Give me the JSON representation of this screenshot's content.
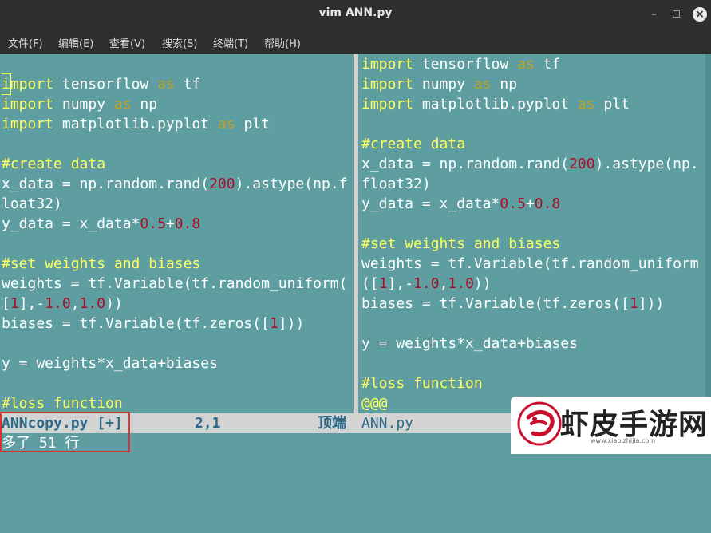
{
  "window": {
    "title": "vim ANN.py"
  },
  "menu": [
    "文件(F)",
    "编辑(E)",
    "查看(V)",
    "搜索(S)",
    "终端(T)",
    "帮助(H)"
  ],
  "left_pane": {
    "lines": [
      [],
      [
        {
          "t": "import",
          "c": "kw"
        },
        {
          "t": " tensorflow ",
          "c": "plain"
        },
        {
          "t": "as",
          "c": "as"
        },
        {
          "t": " tf",
          "c": "plain"
        }
      ],
      [
        {
          "t": "import",
          "c": "kw"
        },
        {
          "t": " numpy ",
          "c": "plain"
        },
        {
          "t": "as",
          "c": "as"
        },
        {
          "t": " np",
          "c": "plain"
        }
      ],
      [
        {
          "t": "import",
          "c": "kw"
        },
        {
          "t": " matplotlib.pyplot ",
          "c": "plain"
        },
        {
          "t": "as",
          "c": "as"
        },
        {
          "t": " plt",
          "c": "plain"
        }
      ],
      [],
      [
        {
          "t": "#create data",
          "c": "cm"
        }
      ],
      [
        {
          "t": "x_data = np.random.rand(",
          "c": "plain"
        },
        {
          "t": "200",
          "c": "num"
        },
        {
          "t": ").astype(np.f",
          "c": "plain"
        }
      ],
      [
        {
          "t": "loat32)",
          "c": "plain"
        }
      ],
      [
        {
          "t": "y_data = x_data*",
          "c": "plain"
        },
        {
          "t": "0.5",
          "c": "num"
        },
        {
          "t": "+",
          "c": "plain"
        },
        {
          "t": "0.8",
          "c": "num"
        }
      ],
      [],
      [
        {
          "t": "#set weights and biases",
          "c": "cm"
        }
      ],
      [
        {
          "t": "weights = tf.Variable(tf.random_uniform(",
          "c": "plain"
        }
      ],
      [
        {
          "t": "[",
          "c": "plain"
        },
        {
          "t": "1",
          "c": "num"
        },
        {
          "t": "],-",
          "c": "plain"
        },
        {
          "t": "1.0",
          "c": "num"
        },
        {
          "t": ",",
          "c": "plain"
        },
        {
          "t": "1.0",
          "c": "num"
        },
        {
          "t": "))",
          "c": "plain"
        }
      ],
      [
        {
          "t": "biases = tf.Variable(tf.zeros([",
          "c": "plain"
        },
        {
          "t": "1",
          "c": "num"
        },
        {
          "t": "]))",
          "c": "plain"
        }
      ],
      [],
      [
        {
          "t": "y = weights*x_data+biases",
          "c": "plain"
        }
      ],
      [],
      [
        {
          "t": "#loss function",
          "c": "cm"
        }
      ]
    ]
  },
  "right_pane": {
    "lines": [
      [
        {
          "t": "import",
          "c": "kw"
        },
        {
          "t": " tensorflow ",
          "c": "plain"
        },
        {
          "t": "as",
          "c": "as"
        },
        {
          "t": " tf",
          "c": "plain"
        }
      ],
      [
        {
          "t": "import",
          "c": "kw"
        },
        {
          "t": " numpy ",
          "c": "plain"
        },
        {
          "t": "as",
          "c": "as"
        },
        {
          "t": " np",
          "c": "plain"
        }
      ],
      [
        {
          "t": "import",
          "c": "kw"
        },
        {
          "t": " matplotlib.pyplot ",
          "c": "plain"
        },
        {
          "t": "as",
          "c": "as"
        },
        {
          "t": " plt",
          "c": "plain"
        }
      ],
      [],
      [
        {
          "t": "#create data",
          "c": "cm"
        }
      ],
      [
        {
          "t": "x_data = np.random.rand(",
          "c": "plain"
        },
        {
          "t": "200",
          "c": "num"
        },
        {
          "t": ").astype(np.",
          "c": "plain"
        }
      ],
      [
        {
          "t": "float32)",
          "c": "plain"
        }
      ],
      [
        {
          "t": "y_data = x_data*",
          "c": "plain"
        },
        {
          "t": "0.5",
          "c": "num"
        },
        {
          "t": "+",
          "c": "plain"
        },
        {
          "t": "0.8",
          "c": "num"
        }
      ],
      [],
      [
        {
          "t": "#set weights and biases",
          "c": "cm"
        }
      ],
      [
        {
          "t": "weights = tf.Variable(tf.random_uniform",
          "c": "plain"
        }
      ],
      [
        {
          "t": "([",
          "c": "plain"
        },
        {
          "t": "1",
          "c": "num"
        },
        {
          "t": "],-",
          "c": "plain"
        },
        {
          "t": "1.0",
          "c": "num"
        },
        {
          "t": ",",
          "c": "plain"
        },
        {
          "t": "1.0",
          "c": "num"
        },
        {
          "t": "))",
          "c": "plain"
        }
      ],
      [
        {
          "t": "biases = tf.Variable(tf.zeros([",
          "c": "plain"
        },
        {
          "t": "1",
          "c": "num"
        },
        {
          "t": "]))",
          "c": "plain"
        }
      ],
      [],
      [
        {
          "t": "y = weights*x_data+biases",
          "c": "plain"
        }
      ],
      [],
      [
        {
          "t": "#loss function",
          "c": "cm"
        }
      ],
      [
        {
          "t": "@@@",
          "c": "cm"
        }
      ]
    ]
  },
  "status": {
    "left_file": "ANNcopy.py [+]",
    "position": "2,1",
    "scroll": "顶端",
    "right_file": "ANN.py"
  },
  "message": "多了 51 行",
  "watermark": {
    "text": "虾皮手游网",
    "url": "www.xiapizhijia.com"
  }
}
